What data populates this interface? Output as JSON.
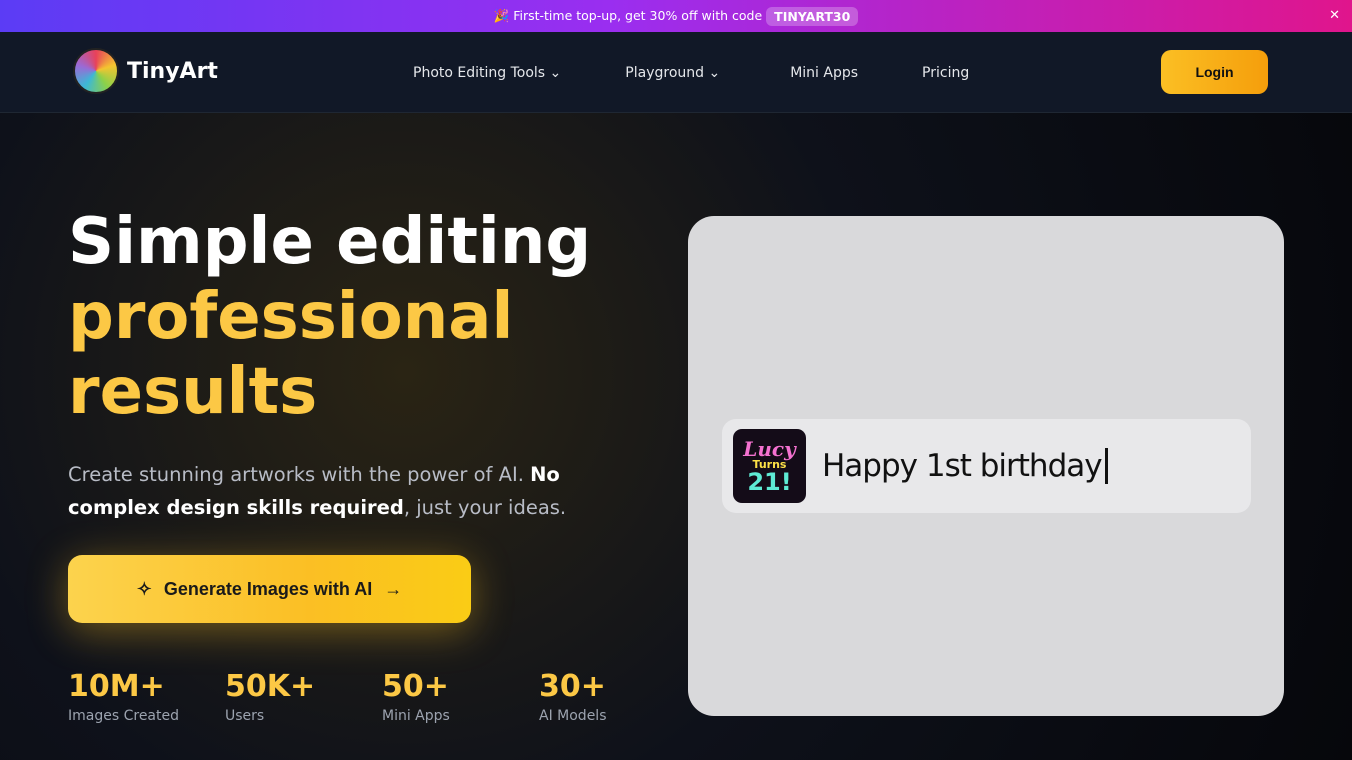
{
  "promo": {
    "icon": "party-popper-icon",
    "text": "🎉 First-time top-up, get 30% off with code",
    "code": "TINYART30",
    "close": "✕"
  },
  "nav": {
    "brand": "TinyArt",
    "links": [
      "Photo Editing Tools",
      "Playground",
      "Mini Apps",
      "Pricing"
    ],
    "login": "Login"
  },
  "hero": {
    "line1": "Simple editing",
    "line2": "professional",
    "line3": "results",
    "sub_a": "Create stunning artworks with the power of AI. ",
    "sub_b": "No complex design skills required",
    "sub_c": ", just your ideas.",
    "cta": "Generate Images with AI"
  },
  "stats": [
    {
      "value": "10M+",
      "label": "Images Created"
    },
    {
      "value": "50K+",
      "label": "Users"
    },
    {
      "value": "50+",
      "label": "Mini Apps"
    },
    {
      "value": "30+",
      "label": "AI Models"
    }
  ],
  "demo": {
    "thumb_l1": "Lucy",
    "thumb_l2": "Turns",
    "thumb_l3": "21!",
    "prompt": "Happy 1st birthday"
  }
}
